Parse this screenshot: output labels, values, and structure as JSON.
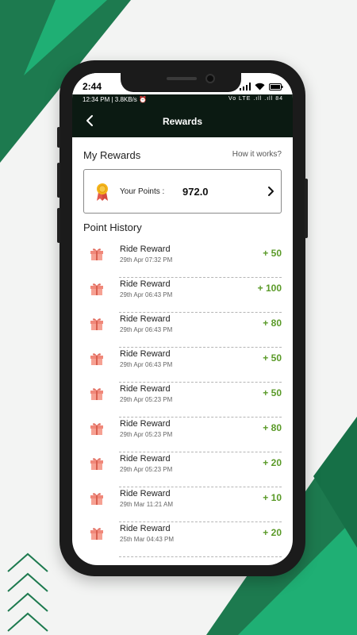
{
  "outer_status": {
    "time": "2:44"
  },
  "app_status": {
    "left": "12:34 PM | 3.8KB/s ⏰",
    "right": "Vo LTE .ıll .ıll 84"
  },
  "header": {
    "title": "Rewards"
  },
  "rewards": {
    "section_title": "My Rewards",
    "how_link": "How it works?",
    "points_label": "Your Points :",
    "points_value": "972.0"
  },
  "history": {
    "section_title": "Point History",
    "items": [
      {
        "title": "Ride Reward",
        "date": "29th Apr 07:32 PM",
        "amount": "+ 50"
      },
      {
        "title": "Ride Reward",
        "date": "29th Apr 06:43 PM",
        "amount": "+ 100"
      },
      {
        "title": "Ride Reward",
        "date": "29th Apr 06:43 PM",
        "amount": "+ 80"
      },
      {
        "title": "Ride Reward",
        "date": "29th Apr 06:43 PM",
        "amount": "+ 50"
      },
      {
        "title": "Ride Reward",
        "date": "29th Apr 05:23 PM",
        "amount": "+ 50"
      },
      {
        "title": "Ride Reward",
        "date": "29th Apr 05:23 PM",
        "amount": "+ 80"
      },
      {
        "title": "Ride Reward",
        "date": "29th Apr 05:23 PM",
        "amount": "+ 20"
      },
      {
        "title": "Ride Reward",
        "date": "29th Mar 11:21 AM",
        "amount": "+ 10"
      },
      {
        "title": "Ride Reward",
        "date": "25th Mar 04:43 PM",
        "amount": "+ 20"
      }
    ]
  },
  "colors": {
    "header_bg": "#0b1a12",
    "amount_green": "#5a9a28",
    "brand_green_dark": "#1d7a4f",
    "brand_green_light": "#1faf74"
  },
  "icons": {
    "back": "chevron-left-icon",
    "medal": "medal-icon",
    "chevron": "chevron-right-icon",
    "gift": "gift-icon"
  }
}
